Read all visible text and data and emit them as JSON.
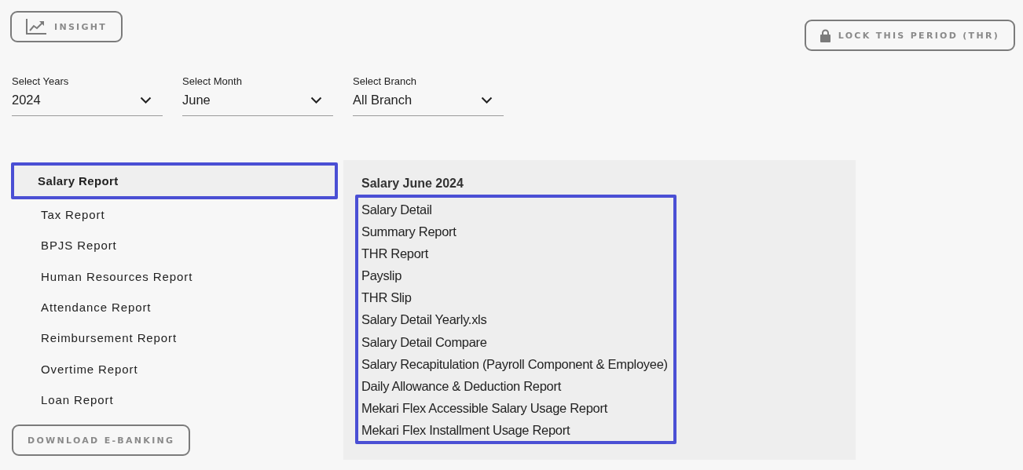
{
  "toolbar": {
    "insight_button": "INSIGHT",
    "lock_button": "LOCK THIS PERIOD (THR)"
  },
  "filters": [
    {
      "label": "Select Years",
      "value": "2024"
    },
    {
      "label": "Select Month",
      "value": "June"
    },
    {
      "label": "Select Branch",
      "value": "All Branch"
    }
  ],
  "sidebar": {
    "items": [
      {
        "label": "Salary Report",
        "selected": true
      },
      {
        "label": "Tax Report",
        "selected": false
      },
      {
        "label": "BPJS Report",
        "selected": false
      },
      {
        "label": "Human Resources Report",
        "selected": false
      },
      {
        "label": "Attendance Report",
        "selected": false
      },
      {
        "label": "Reimbursement Report",
        "selected": false
      },
      {
        "label": "Overtime Report",
        "selected": false
      },
      {
        "label": "Loan Report",
        "selected": false
      }
    ],
    "download_button": "DOWNLOAD E-BANKING"
  },
  "panel": {
    "title": "Salary June 2024",
    "highlighted": true,
    "reports": [
      "Salary Detail",
      "Summary Report",
      "THR Report",
      "Payslip",
      "THR Slip",
      "Salary Detail Yearly.xls",
      "Salary Detail Compare",
      "Salary Recapitulation (Payroll Component & Employee)",
      "Daily Allowance & Deduction Report",
      "Mekari Flex Accessible Salary Usage Report",
      "Mekari Flex Installment Usage Report"
    ]
  }
}
